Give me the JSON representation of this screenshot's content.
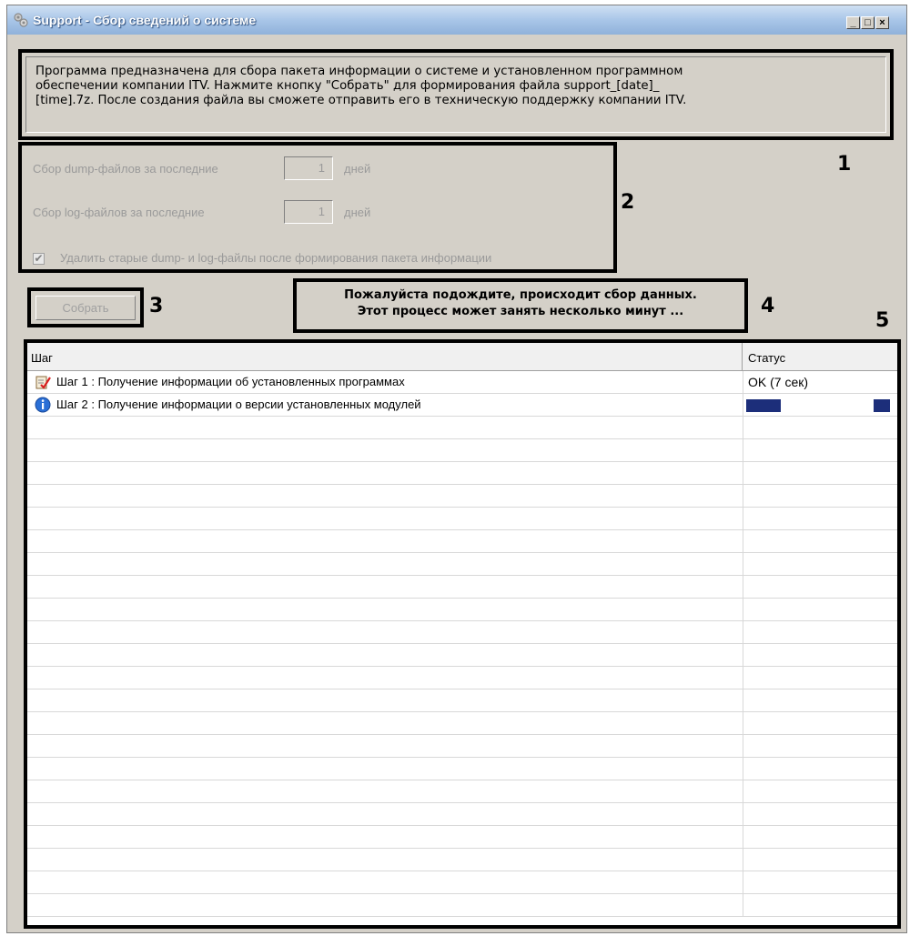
{
  "window": {
    "title": "Support - Сбор сведений о системе",
    "controls": {
      "minimize": "_",
      "maximize": "□",
      "close": "×"
    }
  },
  "info": {
    "text": "Программа предназначена для сбора пакета информации о системе и установленном программном\nобеспечении компании ITV. Нажмите кнопку \"Собрать\" для формирования файла support_[date]_\n[time].7z. После создания файла вы сможете отправить его в техническую поддержку компании ITV."
  },
  "settings": {
    "dump_label": "Сбор dump-файлов за последние",
    "dump_value": "1",
    "dump_unit": "дней",
    "log_label": "Сбор log-файлов за последние",
    "log_value": "1",
    "log_unit": "дней",
    "delete_label": "Удалить старые dump- и log-файлы после формирования пакета информации",
    "delete_checked": true
  },
  "collect_button": {
    "label": "Собрать",
    "enabled": false
  },
  "status_message": {
    "line1": "Пожалуйста подождите, происходит сбор данных.",
    "line2": "Этот процесс может занять несколько минут ..."
  },
  "callouts": {
    "c1": "1",
    "c2": "2",
    "c3": "3",
    "c4": "4",
    "c5": "5"
  },
  "steps_table": {
    "columns": [
      "Шаг",
      "Статус"
    ],
    "rows": [
      {
        "icon": "checklist-icon",
        "step": "Шаг 1 : Получение информации об установленных программах",
        "status": "OK (7 сек)"
      },
      {
        "icon": "info-icon",
        "step": "Шаг 2 : Получение информации о версии установленных модулей",
        "status": ""
      }
    ],
    "empty_rows": 22
  },
  "colors": {
    "progress": "#1c2e7a",
    "titlebar": "#a9c6e8",
    "window_bg": "#d4d0c8"
  }
}
